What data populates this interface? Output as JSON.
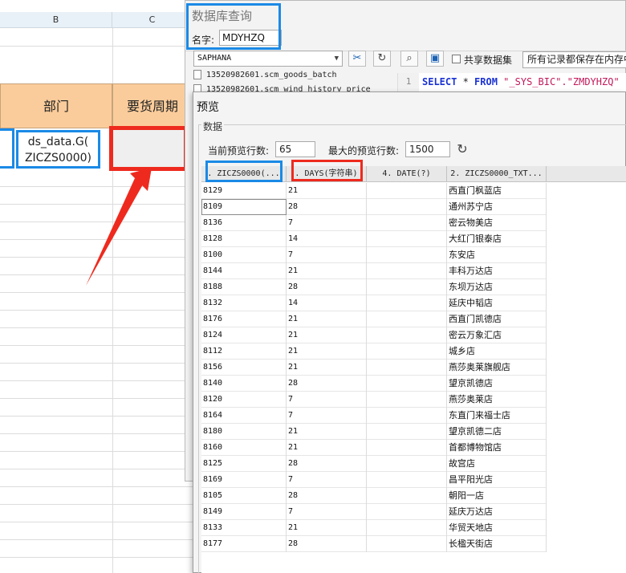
{
  "spreadsheet": {
    "col_b": "B",
    "col_c": "C",
    "header_dept": "部门",
    "header_cycle": "要货周期",
    "cell_ds_line1": "ds_data.G(",
    "cell_ds_line2": "ZICZS0000)"
  },
  "db_query_dialog": {
    "title": "数据库查询",
    "name_label": "名字:",
    "name_value": "MDYHZQ",
    "datasource": "SAPHANA",
    "share_label": "共享数据集",
    "save_option": "所有记录都保存在内存中",
    "tree_items": [
      "13520982601.scm_goods_batch",
      "13520982601.scm_wind_history_price"
    ],
    "sql_line_no": "1",
    "sql_select": "SELECT",
    "sql_star": " * ",
    "sql_from": "FROM",
    "sql_table": " \"_SYS_BIC\".\"ZMDYHZQ\""
  },
  "preview_dialog": {
    "title": "预览",
    "group_label": "数据",
    "current_rows_label": "当前预览行数:",
    "current_rows_value": "65",
    "max_rows_label": "最大的预览行数:",
    "max_rows_value": "1500",
    "columns": [
      ". ZICZS0000(...",
      ". DAYS(字符串)",
      "4. DATE(?)",
      "2. ZICZS0000_TXT..."
    ],
    "rows": [
      [
        "8129",
        "21",
        "",
        "西直门枫蓝店"
      ],
      [
        "8109",
        "28",
        "",
        "通州苏宁店"
      ],
      [
        "8136",
        "7",
        "",
        "密云物美店"
      ],
      [
        "8128",
        "14",
        "",
        "大红门银泰店"
      ],
      [
        "8100",
        "7",
        "",
        "东安店"
      ],
      [
        "8144",
        "21",
        "",
        "丰科万达店"
      ],
      [
        "8188",
        "28",
        "",
        "东坝万达店"
      ],
      [
        "8132",
        "14",
        "",
        "延庆中韬店"
      ],
      [
        "8176",
        "21",
        "",
        "西直门凯德店"
      ],
      [
        "8124",
        "21",
        "",
        "密云万象汇店"
      ],
      [
        "8112",
        "21",
        "",
        "城乡店"
      ],
      [
        "8156",
        "21",
        "",
        "燕莎奥莱旗舰店"
      ],
      [
        "8140",
        "28",
        "",
        "望京凯德店"
      ],
      [
        "8120",
        "7",
        "",
        "燕莎奥莱店"
      ],
      [
        "8164",
        "7",
        "",
        "东直门来福士店"
      ],
      [
        "8180",
        "21",
        "",
        "望京凯德二店"
      ],
      [
        "8160",
        "21",
        "",
        "首都博物馆店"
      ],
      [
        "8125",
        "28",
        "",
        "故宫店"
      ],
      [
        "8169",
        "7",
        "",
        "昌平阳光店"
      ],
      [
        "8105",
        "28",
        "",
        "朝阳一店"
      ],
      [
        "8149",
        "7",
        "",
        "延庆万达店"
      ],
      [
        "8133",
        "21",
        "",
        "华贸天地店"
      ],
      [
        "8177",
        "28",
        "",
        "长楹天街店"
      ]
    ]
  },
  "colors": {
    "highlight_blue": "#1a8ae6",
    "highlight_red": "#ee2a1e",
    "header_orange": "#fbcc9b"
  }
}
